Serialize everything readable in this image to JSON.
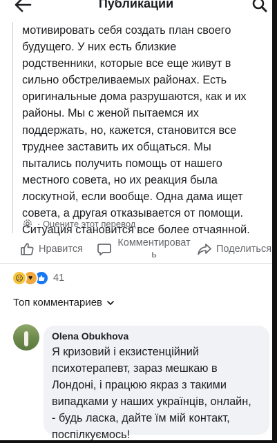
{
  "header": {
    "title": "Публикации",
    "back_icon": "arrow-left-icon",
    "search_icon": "search-icon"
  },
  "post": {
    "text": "мотивировать себя создать план своего\nбудущего. У них есть близкие\nродственники, которые все еще живут в\nсильно обстреливаемых районах. Есть\nоригинальные дома разрушаются, как и их\nрайоны. Мы с женой пытаемся их\nподдержать, но, кажется, становится все\nтруднее заставить их общаться. Мы\nпытались получить помощь от нашего\nместного совета, но их реакция была\nлоскутной, если вообще. Одна дама ищет\nсовета, а другая отказывается от помощи.\nСитуация становится все более отчаянной.",
    "translate_text": "· Оцените этот перевод"
  },
  "actions": {
    "like": "Нравится",
    "comment": "Комментироват\nь",
    "share": "Поделиться"
  },
  "reactions": {
    "count": "41",
    "types": [
      "sad",
      "care",
      "like"
    ]
  },
  "comments_sort": {
    "label": "Топ комментариев"
  },
  "comment": {
    "author": "Olena Obukhova",
    "text": "Я кризовий і екзистенційний\nпсихотерапевт, зараз мешкаю в\nЛондоні, і працюю якраз з такими\nвипадками у наших українців, онлайн,\n- будь ласка, дайте їм мій контакт,\nпоспілкуємось!"
  },
  "colors": {
    "text": "#1c1e21",
    "muted": "#65676b",
    "bubble": "#f0f2f5",
    "like_blue": "#1877f2"
  }
}
